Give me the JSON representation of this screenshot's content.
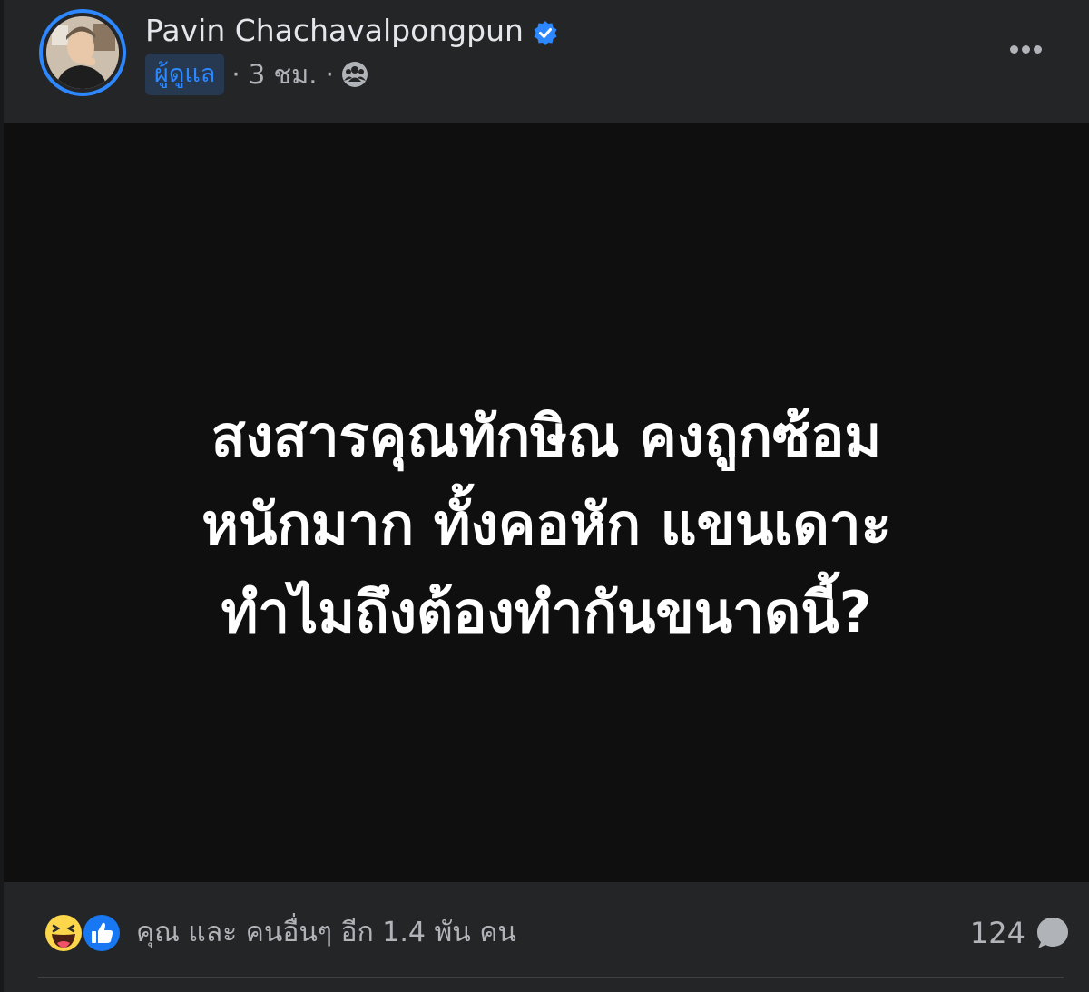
{
  "post": {
    "author": "Pavin Chachavalpongpun",
    "role_badge": "ผู้ดูแล",
    "time": "· 3 ชม. ·",
    "privacy_icon": "group-privacy-icon",
    "verified_icon": "verified-badge-icon",
    "more_icon": "more-options-icon"
  },
  "image_text": {
    "lines": "สงสารคุณทักษิณ คงถูกซ้อม\nหนักมาก ทั้งคอหัก แขนเดาะ\nทำไมถึงต้องทำกันขนาดนี้?"
  },
  "footer": {
    "reactions": [
      "haha-icon",
      "like-icon"
    ],
    "reaction_summary": "คุณ และ คนอื่นๆ อีก 1.4 พัน คน",
    "comment_count": "124",
    "comment_icon": "comment-bubble-icon"
  },
  "colors": {
    "background": "#242526",
    "image_bg": "#0f0f0f",
    "accent": "#2d88ff",
    "secondary_text": "#b0b3b8"
  }
}
